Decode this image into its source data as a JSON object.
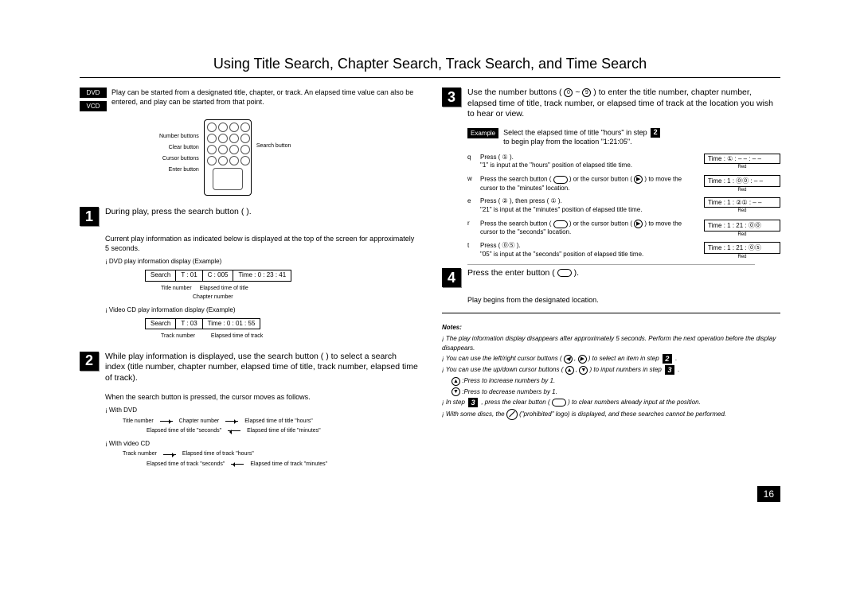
{
  "page_number": "16",
  "title": "Using Title Search, Chapter Search, Track Search, and Time Search",
  "badges": {
    "dvd": "DVD",
    "vcd": "VCD"
  },
  "intro": "Play can be started from a designated title, chapter, or track. An elapsed time value can also be entered, and play can be started from that point.",
  "remote": {
    "left_labels": [
      "Number buttons",
      "Clear button",
      "Cursor buttons",
      "Enter button"
    ],
    "right_label": "Search button"
  },
  "step1": {
    "head": "During play, press the search button (          ).",
    "body": "Current play information as indicated below is displayed at the top of the screen for approximately 5 seconds.",
    "dvd_caption": "¡  DVD play information display (Example)",
    "dvd_box": [
      "Search",
      "T : 01",
      "C : 005",
      "Time : 0 : 23 : 41"
    ],
    "dvd_labels": {
      "a": "Title number",
      "b": "Chapter number",
      "c": "Elapsed time of title"
    },
    "vcd_caption": "¡  Video CD play information display (Example)",
    "vcd_box": [
      "Search",
      "T : 03",
      "Time : 0 : 01 : 55"
    ],
    "vcd_labels": {
      "a": "Track number",
      "b": "Elapsed time of track"
    }
  },
  "step2": {
    "head": "While play information is displayed, use the search button (        ) to select a search index (title number, chapter number, elapsed time of title, track number, elapsed time of track).",
    "body": "When the search button is pressed, the cursor moves as follows.",
    "dvd_label": "¡  With DVD",
    "dvd_row1": [
      "Title number",
      "Chapter number",
      "Elapsed time of title \"hours\""
    ],
    "dvd_row2": [
      "Elapsed time of title \"seconds\"",
      "Elapsed time of title \"minutes\""
    ],
    "vcd_label": "¡  With video CD",
    "vcd_row1": [
      "Track number",
      "Elapsed time of track \"hours\""
    ],
    "vcd_row2": [
      "Elapsed time of track \"seconds\"",
      "Elapsed time of track \"minutes\""
    ]
  },
  "step3": {
    "head": "Use the number buttons (          ~          ) to enter the title number, chapter number, elapsed time of title, track number, or elapsed time of track at the location you wish to hear or view.",
    "example": {
      "label": "Example",
      "text_a": "Select the elapsed time of title \"hours\" in step",
      "text_b": "to begin play from the location \"1:21:05\"."
    },
    "subs": [
      {
        "idx": "q",
        "line1": "Press ( ① ).",
        "line2": "\"1\" is input at the \"hours\" position of elapsed title time.",
        "disp": "Time : ① : – – : – –",
        "red": "Red"
      },
      {
        "idx": "w",
        "line1": "Press the search button (        ) or the cursor button (      ) to move the cursor to the \"minutes\" location.",
        "line2": "",
        "disp": "Time : 1 : ⓪⓪ : – –",
        "red": "Red"
      },
      {
        "idx": "e",
        "line1": "Press ( ② ), then press ( ① ).",
        "line2": "\"21\" is input at the \"minutes\" position of elapsed title time.",
        "disp": "Time : 1 : ②① : – –",
        "red": "Red"
      },
      {
        "idx": "r",
        "line1": "Press the search button (        ) or the cursor button (      ) to move the cursor to the \"seconds\" location.",
        "line2": "",
        "disp": "Time : 1 : 21 : ⓪⓪",
        "red": "Red"
      },
      {
        "idx": "t",
        "line1": "Press ( ⓪⑤ ).",
        "line2": "\"05\" is input at the \"seconds\" position of elapsed title time.",
        "disp": "Time : 1 : 21 : ⓪⑤",
        "red": "Red"
      }
    ]
  },
  "step4": {
    "head": "Press the enter button (        ).",
    "body": "Play begins from the designated location."
  },
  "notes": {
    "heading": "Notes:",
    "items": [
      "The play information display disappears after approximately 5 seconds. Perform the next operation before the display disappears.",
      "You can use the left/right cursor buttons (      ,      ) to select an item in step 2 .",
      "You can use the up/down cursor buttons (      ,      ) to input numbers in step 3 .",
      "      : Press to increase numbers by 1.",
      "      : Press to decrease numbers by 1.",
      "In step 3 , press the clear button (        ) to clear numbers already input at the position.",
      "With some discs, the        (\"prohibited\" logo) is displayed, and these searches cannot be performed."
    ]
  }
}
